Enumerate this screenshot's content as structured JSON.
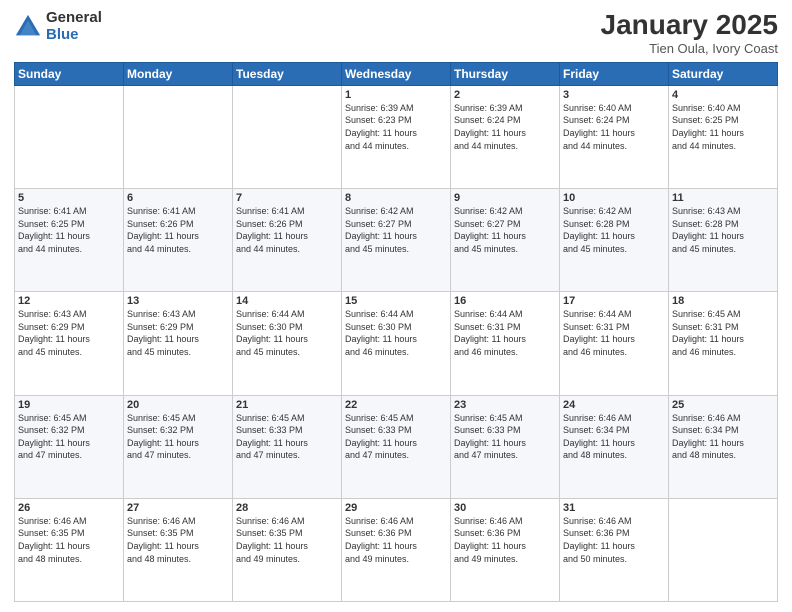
{
  "header": {
    "logo": {
      "general": "General",
      "blue": "Blue"
    },
    "title": "January 2025",
    "location": "Tien Oula, Ivory Coast"
  },
  "days_of_week": [
    "Sunday",
    "Monday",
    "Tuesday",
    "Wednesday",
    "Thursday",
    "Friday",
    "Saturday"
  ],
  "weeks": [
    [
      {
        "num": "",
        "info": ""
      },
      {
        "num": "",
        "info": ""
      },
      {
        "num": "",
        "info": ""
      },
      {
        "num": "1",
        "info": "Sunrise: 6:39 AM\nSunset: 6:23 PM\nDaylight: 11 hours\nand 44 minutes."
      },
      {
        "num": "2",
        "info": "Sunrise: 6:39 AM\nSunset: 6:24 PM\nDaylight: 11 hours\nand 44 minutes."
      },
      {
        "num": "3",
        "info": "Sunrise: 6:40 AM\nSunset: 6:24 PM\nDaylight: 11 hours\nand 44 minutes."
      },
      {
        "num": "4",
        "info": "Sunrise: 6:40 AM\nSunset: 6:25 PM\nDaylight: 11 hours\nand 44 minutes."
      }
    ],
    [
      {
        "num": "5",
        "info": "Sunrise: 6:41 AM\nSunset: 6:25 PM\nDaylight: 11 hours\nand 44 minutes."
      },
      {
        "num": "6",
        "info": "Sunrise: 6:41 AM\nSunset: 6:26 PM\nDaylight: 11 hours\nand 44 minutes."
      },
      {
        "num": "7",
        "info": "Sunrise: 6:41 AM\nSunset: 6:26 PM\nDaylight: 11 hours\nand 44 minutes."
      },
      {
        "num": "8",
        "info": "Sunrise: 6:42 AM\nSunset: 6:27 PM\nDaylight: 11 hours\nand 45 minutes."
      },
      {
        "num": "9",
        "info": "Sunrise: 6:42 AM\nSunset: 6:27 PM\nDaylight: 11 hours\nand 45 minutes."
      },
      {
        "num": "10",
        "info": "Sunrise: 6:42 AM\nSunset: 6:28 PM\nDaylight: 11 hours\nand 45 minutes."
      },
      {
        "num": "11",
        "info": "Sunrise: 6:43 AM\nSunset: 6:28 PM\nDaylight: 11 hours\nand 45 minutes."
      }
    ],
    [
      {
        "num": "12",
        "info": "Sunrise: 6:43 AM\nSunset: 6:29 PM\nDaylight: 11 hours\nand 45 minutes."
      },
      {
        "num": "13",
        "info": "Sunrise: 6:43 AM\nSunset: 6:29 PM\nDaylight: 11 hours\nand 45 minutes."
      },
      {
        "num": "14",
        "info": "Sunrise: 6:44 AM\nSunset: 6:30 PM\nDaylight: 11 hours\nand 45 minutes."
      },
      {
        "num": "15",
        "info": "Sunrise: 6:44 AM\nSunset: 6:30 PM\nDaylight: 11 hours\nand 46 minutes."
      },
      {
        "num": "16",
        "info": "Sunrise: 6:44 AM\nSunset: 6:31 PM\nDaylight: 11 hours\nand 46 minutes."
      },
      {
        "num": "17",
        "info": "Sunrise: 6:44 AM\nSunset: 6:31 PM\nDaylight: 11 hours\nand 46 minutes."
      },
      {
        "num": "18",
        "info": "Sunrise: 6:45 AM\nSunset: 6:31 PM\nDaylight: 11 hours\nand 46 minutes."
      }
    ],
    [
      {
        "num": "19",
        "info": "Sunrise: 6:45 AM\nSunset: 6:32 PM\nDaylight: 11 hours\nand 47 minutes."
      },
      {
        "num": "20",
        "info": "Sunrise: 6:45 AM\nSunset: 6:32 PM\nDaylight: 11 hours\nand 47 minutes."
      },
      {
        "num": "21",
        "info": "Sunrise: 6:45 AM\nSunset: 6:33 PM\nDaylight: 11 hours\nand 47 minutes."
      },
      {
        "num": "22",
        "info": "Sunrise: 6:45 AM\nSunset: 6:33 PM\nDaylight: 11 hours\nand 47 minutes."
      },
      {
        "num": "23",
        "info": "Sunrise: 6:45 AM\nSunset: 6:33 PM\nDaylight: 11 hours\nand 47 minutes."
      },
      {
        "num": "24",
        "info": "Sunrise: 6:46 AM\nSunset: 6:34 PM\nDaylight: 11 hours\nand 48 minutes."
      },
      {
        "num": "25",
        "info": "Sunrise: 6:46 AM\nSunset: 6:34 PM\nDaylight: 11 hours\nand 48 minutes."
      }
    ],
    [
      {
        "num": "26",
        "info": "Sunrise: 6:46 AM\nSunset: 6:35 PM\nDaylight: 11 hours\nand 48 minutes."
      },
      {
        "num": "27",
        "info": "Sunrise: 6:46 AM\nSunset: 6:35 PM\nDaylight: 11 hours\nand 48 minutes."
      },
      {
        "num": "28",
        "info": "Sunrise: 6:46 AM\nSunset: 6:35 PM\nDaylight: 11 hours\nand 49 minutes."
      },
      {
        "num": "29",
        "info": "Sunrise: 6:46 AM\nSunset: 6:36 PM\nDaylight: 11 hours\nand 49 minutes."
      },
      {
        "num": "30",
        "info": "Sunrise: 6:46 AM\nSunset: 6:36 PM\nDaylight: 11 hours\nand 49 minutes."
      },
      {
        "num": "31",
        "info": "Sunrise: 6:46 AM\nSunset: 6:36 PM\nDaylight: 11 hours\nand 50 minutes."
      },
      {
        "num": "",
        "info": ""
      }
    ]
  ]
}
